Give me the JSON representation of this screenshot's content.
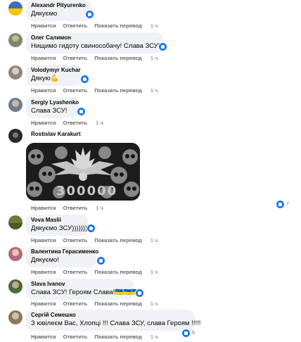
{
  "actions": {
    "like": "Нравится",
    "reply": "Ответить",
    "translate": "Показать перевод"
  },
  "comments": [
    {
      "author": "Alexandr Pityurenko",
      "text": "Дякуємо",
      "time": "1 ч.",
      "avatar_color": "#3b6fb6"
    },
    {
      "author": "Олег Салимон",
      "text": "Нищимо гидоту свиноcобачу! Слава ЗСУ!",
      "time": "1 ч.",
      "avatar_color": "#7a8a70"
    },
    {
      "author": "Volodymyr Kuchar",
      "text": "Дякую💪",
      "time": "1 ч.",
      "avatar_color": "#8b8680"
    },
    {
      "author": "Sergiy Lyashenko",
      "text": "Слава ЗСУ!",
      "time": "1 ч.",
      "avatar_color": "#6d7d8f"
    },
    {
      "author": "Rostislav Karakurt",
      "text": "",
      "time": "1 ч.",
      "avatar_color": "#2a2a2a",
      "image_caption": "300000"
    },
    {
      "author": "Vova Maslii",
      "text": "Дякуємо ЗСУ)))))))",
      "time": "1 ч.",
      "avatar_color": "#6b7b3a"
    },
    {
      "author": "Валентина Герасименко",
      "text": "Дякуємо!",
      "time": "1 ч.",
      "avatar_color": "#b06a7a"
    },
    {
      "author": "Slava Ivanov",
      "text": "Слава ЗСУ! Героям Слава!🇺🇦🇺🇦🇺🇦",
      "time": "1 ч.",
      "avatar_color": "#4f6a3a"
    },
    {
      "author": "Сергій Семешко",
      "text": "З ювілеєм Вас, Хлопці !!! Слава ЗСУ, слава Героям !!!!!",
      "time": "1 ч.",
      "avatar_color": "#8a7a5a"
    }
  ],
  "reaction_counts": {
    "rostislav": "7",
    "sergiy_semeshko": "5"
  }
}
